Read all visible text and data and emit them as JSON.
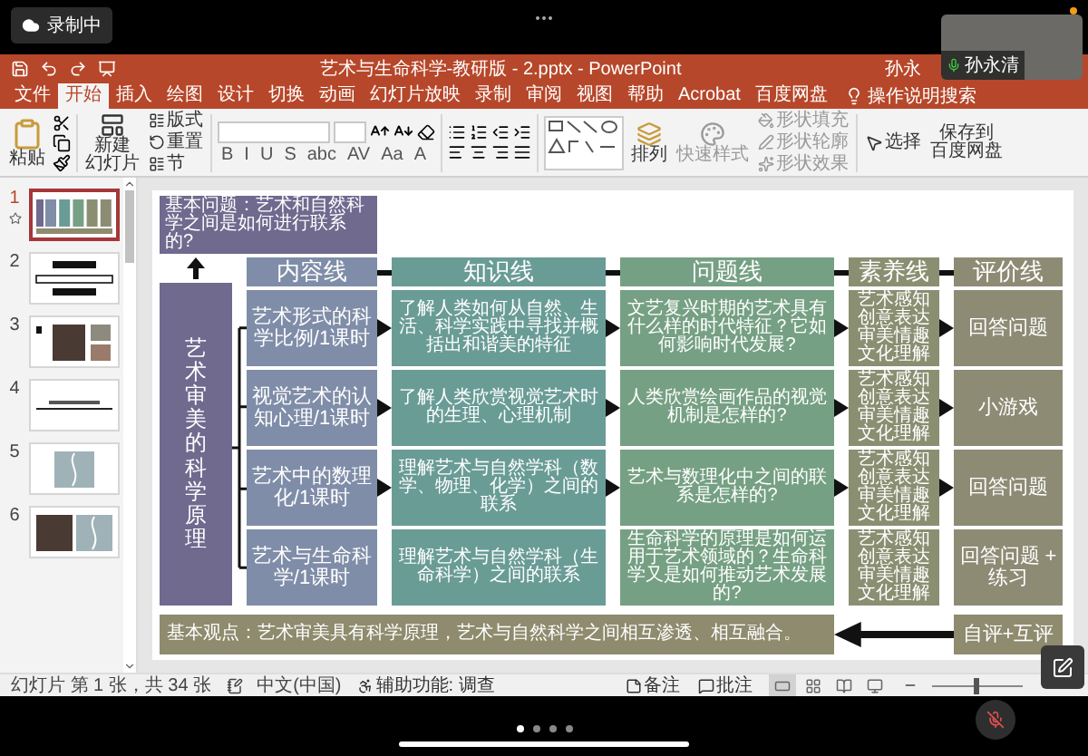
{
  "top_bar": {
    "recording": "录制中"
  },
  "video": {
    "name": "孙永清"
  },
  "window": {
    "title": "艺术与生命科学-教研版 - 2.pptx - PowerPoint",
    "user": "孙永"
  },
  "tabs": [
    {
      "label": "文件",
      "selected": false
    },
    {
      "label": "开始",
      "selected": true
    },
    {
      "label": "插入",
      "selected": false
    },
    {
      "label": "绘图",
      "selected": false
    },
    {
      "label": "设计",
      "selected": false
    },
    {
      "label": "切换",
      "selected": false
    },
    {
      "label": "动画",
      "selected": false
    },
    {
      "label": "幻灯片放映",
      "selected": false
    },
    {
      "label": "录制",
      "selected": false
    },
    {
      "label": "审阅",
      "selected": false
    },
    {
      "label": "视图",
      "selected": false
    },
    {
      "label": "帮助",
      "selected": false
    },
    {
      "label": "Acrobat",
      "selected": false
    },
    {
      "label": "百度网盘",
      "selected": false
    }
  ],
  "search": {
    "placeholder": "操作说明搜索"
  },
  "ribbon": {
    "paste": "粘贴",
    "new_slide": [
      "新建",
      "幻灯片"
    ],
    "slide_options": [
      "版式",
      "重置",
      "节"
    ],
    "font_buttons": [
      "B",
      "I",
      "U",
      "S",
      "abc",
      "AV",
      "Aa",
      "A"
    ],
    "arrange": "排列",
    "quick_styles": {
      "label": "快速样式",
      "disabled": true
    },
    "shape_format": [
      {
        "label": "形状填充",
        "disabled": true
      },
      {
        "label": "形状轮廓",
        "disabled": true
      },
      {
        "label": "形状效果",
        "disabled": true
      }
    ],
    "select": "选择",
    "save_cloud": [
      "保存到",
      "百度网盘"
    ]
  },
  "slides": [
    {
      "number": "1",
      "selected": true,
      "animated": true,
      "kind": "diagram"
    },
    {
      "number": "2",
      "selected": false,
      "animated": false,
      "kind": "flow"
    },
    {
      "number": "3",
      "selected": false,
      "animated": false,
      "kind": "photos"
    },
    {
      "number": "4",
      "selected": false,
      "animated": false,
      "kind": "text"
    },
    {
      "number": "5",
      "selected": false,
      "animated": false,
      "kind": "scroll"
    },
    {
      "number": "6",
      "selected": false,
      "animated": false,
      "kind": "photo_scroll"
    }
  ],
  "slide": {
    "question": "基本问题：艺术和自然科学之间是如何进行联系的?",
    "side_label": "艺术审美的科学原理",
    "headers": [
      "内容线",
      "知识线",
      "问题线",
      "素养线",
      "评价线"
    ],
    "rows": [
      {
        "content": "艺术形式的科学比例/1课时",
        "knowledge": "了解人类如何从自然、生活、科学实践中寻找并概括出和谐美的特征",
        "question": "文艺复兴时期的艺术具有什么样的时代特征？它如何影响时代发展?",
        "literacy": [
          "艺术感知",
          "创意表达",
          "审美情趣",
          "文化理解"
        ],
        "evaluation": "回答问题",
        "arrows": true
      },
      {
        "content": "视觉艺术的认知心理/1课时",
        "knowledge": "了解人类欣赏视觉艺术时的生理、心理机制",
        "question": "人类欣赏绘画作品的视觉机制是怎样的?",
        "literacy": [
          "艺术感知",
          "创意表达",
          "审美情趣",
          "文化理解"
        ],
        "evaluation": "小游戏",
        "arrows": true
      },
      {
        "content": "艺术中的数理化/1课时",
        "knowledge": "理解艺术与自然学科（数学、物理、化学）之间的联系",
        "question": "艺术与数理化中之间的联系是怎样的?",
        "literacy": [
          "艺术感知",
          "创意表达",
          "审美情趣",
          "文化理解"
        ],
        "evaluation": "回答问题",
        "arrows": true
      },
      {
        "content": "艺术与生命科学/1课时",
        "knowledge": "理解艺术与自然学科（生命科学）之间的联系",
        "question": "生命科学的原理是如何运用于艺术领域的？生命科学又是如何推动艺术发展的?",
        "literacy": [
          "艺术感知",
          "创意表达",
          "审美情趣",
          "文化理解"
        ],
        "evaluation": "回答问题 + 练习",
        "arrows": false
      }
    ],
    "bottom": "基本观点：艺术审美具有科学原理，艺术与自然科学之间相互渗透、相互融合。",
    "final_evaluation": "自评+互评"
  },
  "status_bar": {
    "slide_count": "幻灯片 第 1 张，共 34 张",
    "language": "中文(中国)",
    "accessibility": "辅助功能: 调查",
    "notes": "备注",
    "comments": "批注",
    "views": [
      {
        "selected": true
      },
      {
        "selected": false
      },
      {
        "selected": false
      },
      {
        "selected": false
      }
    ],
    "zoom": {
      "level": 0.45
    }
  },
  "bottom": {
    "mic_muted": true,
    "pages": [
      {
        "selected": true
      },
      {
        "selected": false
      },
      {
        "selected": false
      },
      {
        "selected": false
      }
    ]
  }
}
